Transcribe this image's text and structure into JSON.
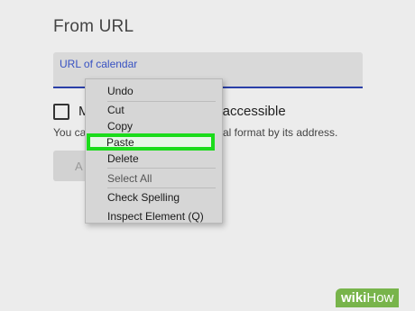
{
  "page": {
    "heading": "From URL",
    "url_placeholder": "URL of calendar",
    "checkbox_label_left": "M",
    "checkbox_label_right": "y accessible",
    "help_text_left": "You ca",
    "help_text_right": "al format by its address.",
    "add_button_label": "A"
  },
  "context_menu": {
    "items": [
      {
        "label": "Undo",
        "enabled": true
      },
      {
        "label": "Cut",
        "enabled": true
      },
      {
        "label": "Copy",
        "enabled": true
      },
      {
        "label": "Paste",
        "enabled": true,
        "highlighted": true
      },
      {
        "label": "Delete",
        "enabled": true
      },
      {
        "label": "Select All",
        "enabled": false
      },
      {
        "label": "Check Spelling",
        "enabled": true
      },
      {
        "label": "Inspect Element (Q)",
        "enabled": true
      }
    ]
  },
  "watermark": {
    "prefix": "wiki",
    "suffix": "How"
  },
  "colors": {
    "highlight": "#1bdc1b",
    "field_underline": "#2a3fa8",
    "placeholder": "#3852c2"
  }
}
